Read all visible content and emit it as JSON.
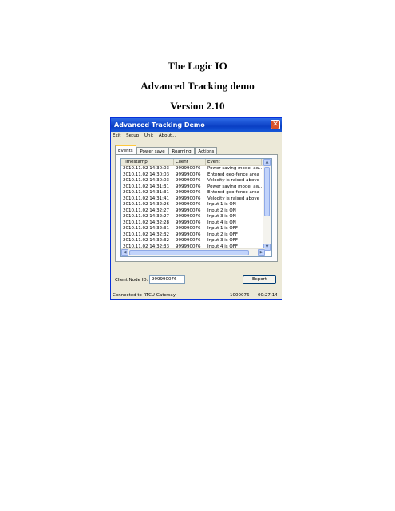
{
  "document": {
    "title": "The Logic IO",
    "subtitle": "Advanced Tracking demo",
    "version": "Version 2.10"
  },
  "window": {
    "title": "Advanced Tracking Demo",
    "close_label": "✕"
  },
  "menu": [
    "Exit",
    "Setup",
    "Unit",
    "About..."
  ],
  "tabs": [
    "Events",
    "Power save",
    "Roaming",
    "Actions"
  ],
  "table": {
    "columns": [
      "Timestamp",
      "Client",
      "Event"
    ],
    "rows": [
      [
        "2010.11.02 14:30:03",
        "999990076",
        "Power saving mode, aw..."
      ],
      [
        "2010.11.02 14:30:03",
        "999990076",
        "Entered geo-fence area"
      ],
      [
        "2010.11.02 14:30:03",
        "999990076",
        "Velocity is raised above"
      ],
      [
        "2010.11.02 14:31:31",
        "999990076",
        "Power saving mode, aw..."
      ],
      [
        "2010.11.02 14:31:31",
        "999990076",
        "Entered geo-fence area"
      ],
      [
        "2010.11.02 14:31:41",
        "999990076",
        "Velocity is raised above"
      ],
      [
        "2010.11.02 14:32:26",
        "999990076",
        "Input 1 is ON"
      ],
      [
        "2010.11.02 14:32:27",
        "999990076",
        "Input 2 is ON"
      ],
      [
        "2010.11.02 14:32:27",
        "999990076",
        "Input 3 is ON"
      ],
      [
        "2010.11.02 14:32:28",
        "999990076",
        "Input 4 is ON"
      ],
      [
        "2010.11.02 14:32:31",
        "999990076",
        "Input 1 is OFF"
      ],
      [
        "2010.11.02 14:32:32",
        "999990076",
        "Input 2 is OFF"
      ],
      [
        "2010.11.02 14:32:32",
        "999990076",
        "Input 3 is OFF"
      ],
      [
        "2010.11.02 14:32:33",
        "999990076",
        "Input 4 is OFF"
      ]
    ]
  },
  "bottom": {
    "node_label": "Client Node ID:",
    "node_value": "999990076",
    "export_label": "Export"
  },
  "status": {
    "connection": "Connected to RTCU Gateway",
    "node": "1000076",
    "time": "00:27:14"
  },
  "icons": {
    "scroll_up": "▲",
    "scroll_down": "▼",
    "scroll_left": "◀",
    "scroll_right": "▶"
  }
}
